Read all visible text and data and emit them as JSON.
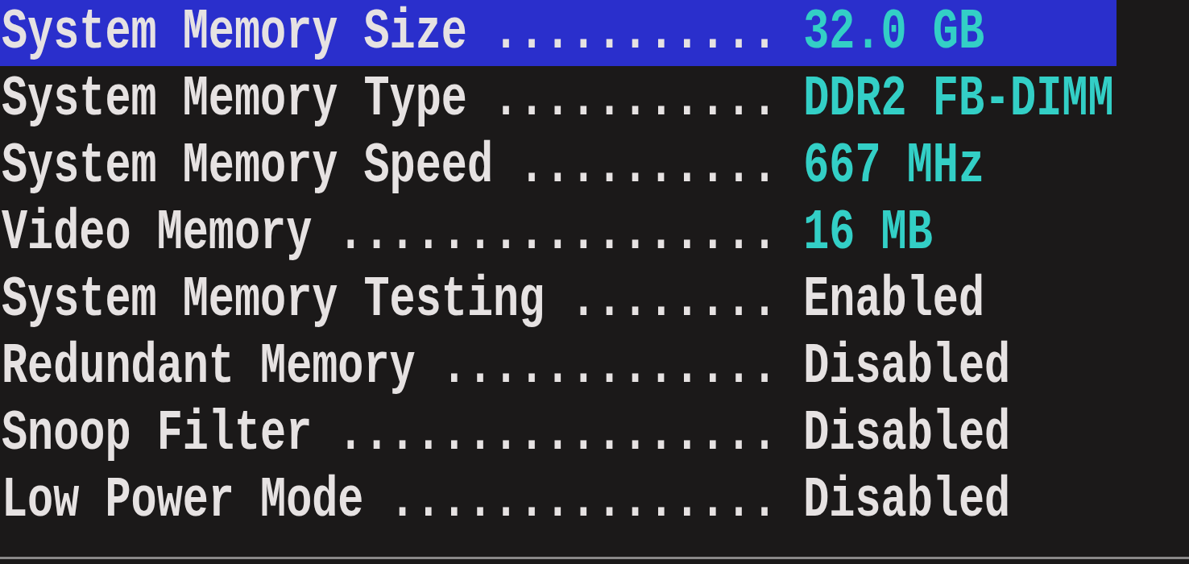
{
  "menu": {
    "rows": [
      {
        "label": "System Memory Size",
        "leader": "...........",
        "value": "32.0 GB",
        "kind": "info",
        "selected": true
      },
      {
        "label": "System Memory Type",
        "leader": "...........",
        "value": "DDR2 FB-DIMM",
        "kind": "info",
        "selected": false
      },
      {
        "label": "System Memory Speed",
        "leader": "..........",
        "value": "667 MHz",
        "kind": "info",
        "selected": false
      },
      {
        "label": "Video Memory",
        "leader": ".................",
        "value": "16 MB",
        "kind": "info",
        "selected": false
      },
      {
        "label": "System Memory Testing",
        "leader": "........",
        "value": "Enabled",
        "kind": "option",
        "selected": false
      },
      {
        "label": "Redundant Memory",
        "leader": ".............",
        "value": "Disabled",
        "kind": "option",
        "selected": false
      },
      {
        "label": "Snoop Filter",
        "leader": ".................",
        "value": "Disabled",
        "kind": "option",
        "selected": false
      },
      {
        "label": "Low Power Mode",
        "leader": "...............",
        "value": "Disabled",
        "kind": "option",
        "selected": false
      }
    ]
  }
}
